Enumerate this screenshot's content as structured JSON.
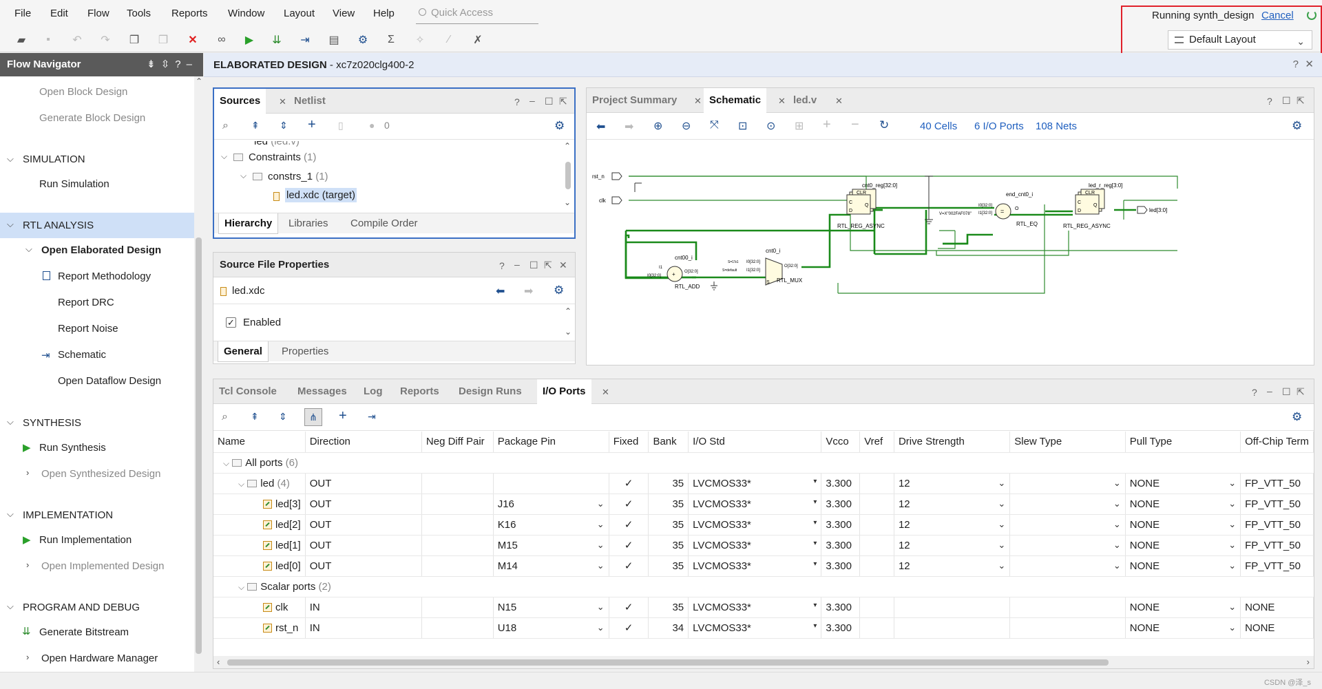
{
  "menu": [
    "File",
    "Edit",
    "Flow",
    "Tools",
    "Reports",
    "Window",
    "Layout",
    "View",
    "Help"
  ],
  "quick_access_placeholder": "Quick Access",
  "run_status": {
    "text": "Running synth_design",
    "cancel": "Cancel",
    "layout": "Default Layout"
  },
  "flow_nav": {
    "title": "Flow Navigator",
    "items": [
      {
        "label": "Open Block Design",
        "disabled": true
      },
      {
        "label": "Generate Block Design",
        "disabled": true
      },
      {
        "label": "SIMULATION",
        "section": true
      },
      {
        "label": "Run Simulation"
      },
      {
        "label": "RTL ANALYSIS",
        "section": true
      },
      {
        "label": "Open Elaborated Design"
      },
      {
        "label": "Report Methodology"
      },
      {
        "label": "Report DRC"
      },
      {
        "label": "Report Noise"
      },
      {
        "label": "Schematic"
      },
      {
        "label": "Open Dataflow Design"
      },
      {
        "label": "SYNTHESIS",
        "section": true
      },
      {
        "label": "Run Synthesis"
      },
      {
        "label": "Open Synthesized Design",
        "disabled": true
      },
      {
        "label": "IMPLEMENTATION",
        "section": true
      },
      {
        "label": "Run Implementation"
      },
      {
        "label": "Open Implemented Design",
        "disabled": true
      },
      {
        "label": "PROGRAM AND DEBUG",
        "section": true
      },
      {
        "label": "Generate Bitstream"
      },
      {
        "label": "Open Hardware Manager"
      }
    ]
  },
  "elaborated": {
    "title": "ELABORATED DESIGN",
    "part": " - xc7z020clg400-2"
  },
  "sources": {
    "tabs": [
      "Sources",
      "Netlist"
    ],
    "count": "0",
    "tree": [
      {
        "label": "led",
        "suffix": "(led.v)"
      },
      {
        "label": "Constraints",
        "suffix": "(1)"
      },
      {
        "label": "constrs_1",
        "suffix": "(1)"
      },
      {
        "label": "led.xdc (target)",
        "suffix": ""
      }
    ],
    "bottom_tabs": [
      "Hierarchy",
      "Libraries",
      "Compile Order"
    ]
  },
  "sfp": {
    "title": "Source File Properties",
    "file": "led.xdc",
    "enabled": "Enabled",
    "tabs": [
      "General",
      "Properties"
    ]
  },
  "schematic": {
    "tabs": [
      "Project Summary",
      "Schematic",
      "led.v"
    ],
    "cells": "40 Cells",
    "io_ports": "6 I/O Ports",
    "nets": "108 Nets",
    "labels": {
      "rst_n": "rst_n",
      "clk": "clk",
      "led_out": "led[3:0]",
      "cnt0_reg": "cnt0_reg[32:0]",
      "cnt0_type": "RTL_REG_ASYNC",
      "end_cnt0": "end_cnt0_i",
      "eq_type": "RTL_EQ",
      "led_r_reg": "led_r_reg[3:0]",
      "led_type": "RTL_REG_ASYNC",
      "cnt00": "cnt00_i",
      "add_type": "RTL_ADD",
      "cnt0_i": "cnt0_i",
      "mux_type": "RTL_MUX",
      "const": "V=X\"002FAF078\"",
      "clr": "CLR",
      "c": "C",
      "d": "D",
      "q": "Q",
      "o": "O",
      "s": "S",
      "i0_32": "I0[32:0]",
      "i1_32": "I1[32:0]",
      "o_32": "O[32:0]",
      "i1": "I1",
      "s1b1": "S=1'b1",
      "sdefault": "S=default",
      "plus": "+",
      "eq": "="
    }
  },
  "console": {
    "tabs": [
      "Tcl Console",
      "Messages",
      "Log",
      "Reports",
      "Design Runs",
      "I/O Ports"
    ],
    "columns": [
      "Name",
      "Direction",
      "Neg Diff Pair",
      "Package Pin",
      "Fixed",
      "Bank",
      "I/O Std",
      "Vcco",
      "Vref",
      "Drive Strength",
      "Slew Type",
      "Pull Type",
      "Off-Chip Term"
    ],
    "rows": [
      {
        "name": "All ports",
        "count": "(6)",
        "level": 0,
        "group": true
      },
      {
        "name": "led",
        "count": "(4)",
        "level": 1,
        "group": true,
        "dir": "OUT",
        "fixed": "✓",
        "bank": "35",
        "std": "LVCMOS33*",
        "vcco": "3.300",
        "drive": "12",
        "pull": "NONE",
        "term": "FP_VTT_50"
      },
      {
        "name": "led[3]",
        "level": 2,
        "dir": "OUT",
        "pin": "J16",
        "fixed": "✓",
        "bank": "35",
        "std": "LVCMOS33*",
        "vcco": "3.300",
        "drive": "12",
        "pull": "NONE",
        "term": "FP_VTT_50"
      },
      {
        "name": "led[2]",
        "level": 2,
        "dir": "OUT",
        "pin": "K16",
        "fixed": "✓",
        "bank": "35",
        "std": "LVCMOS33*",
        "vcco": "3.300",
        "drive": "12",
        "pull": "NONE",
        "term": "FP_VTT_50"
      },
      {
        "name": "led[1]",
        "level": 2,
        "dir": "OUT",
        "pin": "M15",
        "fixed": "✓",
        "bank": "35",
        "std": "LVCMOS33*",
        "vcco": "3.300",
        "drive": "12",
        "pull": "NONE",
        "term": "FP_VTT_50"
      },
      {
        "name": "led[0]",
        "level": 2,
        "dir": "OUT",
        "pin": "M14",
        "fixed": "✓",
        "bank": "35",
        "std": "LVCMOS33*",
        "vcco": "3.300",
        "drive": "12",
        "pull": "NONE",
        "term": "FP_VTT_50"
      },
      {
        "name": "Scalar ports",
        "count": "(2)",
        "level": 1,
        "group": true
      },
      {
        "name": "clk",
        "level": 2,
        "dir": "IN",
        "pin": "N15",
        "fixed": "✓",
        "bank": "35",
        "std": "LVCMOS33*",
        "vcco": "3.300",
        "drive": "",
        "pull": "NONE",
        "term": "NONE"
      },
      {
        "name": "rst_n",
        "level": 2,
        "dir": "IN",
        "pin": "U18",
        "fixed": "✓",
        "bank": "34",
        "std": "LVCMOS33*",
        "vcco": "3.300",
        "drive": "",
        "pull": "NONE",
        "term": "NONE"
      }
    ]
  },
  "watermark": "CSDN @泽_s"
}
